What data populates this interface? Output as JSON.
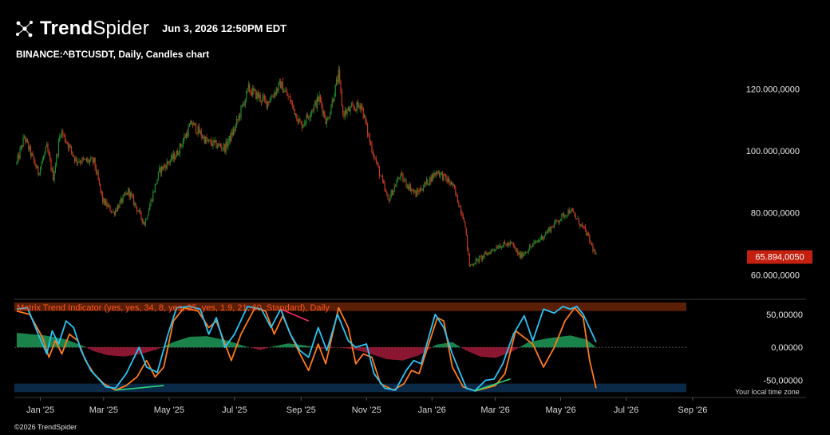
{
  "header": {
    "brand_bold": "Trend",
    "brand_light": "Spider",
    "logo_icon": "network-nodes-icon",
    "timestamp": "Jun 3, 2026 12:50PM EDT",
    "symbol_line": "BINANCE:^BTCUSDT, Daily, Candles chart"
  },
  "footer": {
    "copyright": "©2026 TrendSpider",
    "timezone_note": "Your local time zone"
  },
  "colors": {
    "up": "#1f8a2e",
    "down": "#c33a1c",
    "price_badge": "#c3200f",
    "fast_line": "#2ac4f5",
    "slow_line": "#ff7a1a",
    "ob_zone": "#5a1f05",
    "os_zone": "#0b2a48",
    "hist_pos": "#1f9a58",
    "hist_neg": "#a31a3a",
    "bear_div": "#ff2a6a",
    "bull_div": "#2fd87a"
  },
  "chart_data": [
    {
      "type": "candlestick",
      "title": "BINANCE:^BTCUSDT, Daily, Candles chart",
      "x_range": [
        "2024-12-10",
        "2026-06-03"
      ],
      "ylim": [
        56000,
        126000
      ],
      "yticks": [
        60000,
        80000,
        100000,
        120000
      ],
      "ytick_labels": [
        "60.000,0000",
        "80.000,0000",
        "100.000,0000",
        "120.000,0000"
      ],
      "last_price": 65894.005,
      "last_price_label": "65.894,0050",
      "close_path": [
        [
          "2024-12-10",
          96000
        ],
        [
          "2024-12-17",
          104500
        ],
        [
          "2024-12-30",
          93000
        ],
        [
          "2025-01-07",
          101000
        ],
        [
          "2025-01-13",
          91500
        ],
        [
          "2025-01-20",
          106500
        ],
        [
          "2025-01-27",
          102000
        ],
        [
          "2025-02-03",
          97000
        ],
        [
          "2025-02-20",
          96500
        ],
        [
          "2025-02-28",
          84000
        ],
        [
          "2025-03-10",
          80000
        ],
        [
          "2025-03-24",
          87000
        ],
        [
          "2025-04-08",
          76500
        ],
        [
          "2025-04-22",
          93500
        ],
        [
          "2025-05-08",
          99000
        ],
        [
          "2025-05-22",
          109000
        ],
        [
          "2025-06-05",
          103000
        ],
        [
          "2025-06-22",
          101000
        ],
        [
          "2025-07-01",
          107000
        ],
        [
          "2025-07-14",
          120000
        ],
        [
          "2025-07-31",
          115500
        ],
        [
          "2025-08-13",
          121500
        ],
        [
          "2025-08-22",
          116000
        ],
        [
          "2025-09-01",
          108000
        ],
        [
          "2025-09-18",
          117000
        ],
        [
          "2025-09-25",
          109000
        ],
        [
          "2025-10-06",
          124500
        ],
        [
          "2025-10-10",
          112000
        ],
        [
          "2025-10-27",
          115000
        ],
        [
          "2025-11-04",
          103000
        ],
        [
          "2025-11-21",
          84000
        ],
        [
          "2025-12-02",
          92000
        ],
        [
          "2025-12-17",
          86000
        ],
        [
          "2026-01-06",
          93500
        ],
        [
          "2026-01-20",
          89000
        ],
        [
          "2026-01-31",
          78000
        ],
        [
          "2026-02-05",
          63000
        ],
        [
          "2026-02-20",
          66500
        ],
        [
          "2026-03-04",
          69500
        ],
        [
          "2026-03-16",
          70000
        ],
        [
          "2026-03-24",
          66000
        ],
        [
          "2026-04-13",
          72000
        ],
        [
          "2026-04-28",
          77500
        ],
        [
          "2026-05-10",
          81000
        ],
        [
          "2026-05-25",
          73500
        ],
        [
          "2026-06-03",
          65894
        ]
      ]
    },
    {
      "type": "line",
      "title": "Matrix Trend Indicator (yes, yes, 34, 8, yes, 35, yes, 1.9, 21, 60, Standard), Daily",
      "ylim": [
        -70,
        68
      ],
      "yticks": [
        50,
        0,
        -50
      ],
      "ytick_labels": [
        "50,00000",
        "0,00000",
        "-50,00000"
      ],
      "bands": {
        "overbought": [
          55,
          68
        ],
        "oversold": [
          -68,
          -55
        ]
      },
      "series": [
        {
          "role": "fast",
          "values": [
            [
              "2024-12-10",
              58
            ],
            [
              "2024-12-20",
              60
            ],
            [
              "2024-12-30",
              20
            ],
            [
              "2025-01-07",
              -10
            ],
            [
              "2025-01-12",
              25
            ],
            [
              "2025-01-18",
              5
            ],
            [
              "2025-01-25",
              40
            ],
            [
              "2025-02-01",
              30
            ],
            [
              "2025-02-08",
              -5
            ],
            [
              "2025-02-17",
              -35
            ],
            [
              "2025-03-03",
              -60
            ],
            [
              "2025-03-12",
              -62
            ],
            [
              "2025-03-22",
              -40
            ],
            [
              "2025-04-03",
              0
            ],
            [
              "2025-04-10",
              -30
            ],
            [
              "2025-04-20",
              -38
            ],
            [
              "2025-04-30",
              20
            ],
            [
              "2025-05-08",
              60
            ],
            [
              "2025-05-20",
              62
            ],
            [
              "2025-05-30",
              58
            ],
            [
              "2025-06-07",
              20
            ],
            [
              "2025-06-14",
              45
            ],
            [
              "2025-06-22",
              0
            ],
            [
              "2025-07-01",
              20
            ],
            [
              "2025-07-13",
              62
            ],
            [
              "2025-07-26",
              58
            ],
            [
              "2025-08-04",
              30
            ],
            [
              "2025-08-13",
              58
            ],
            [
              "2025-08-22",
              20
            ],
            [
              "2025-08-31",
              -5
            ],
            [
              "2025-09-08",
              -15
            ],
            [
              "2025-09-17",
              30
            ],
            [
              "2025-09-25",
              -5
            ],
            [
              "2025-10-05",
              50
            ],
            [
              "2025-10-15",
              10
            ],
            [
              "2025-10-22",
              0
            ],
            [
              "2025-11-01",
              5
            ],
            [
              "2025-11-08",
              -40
            ],
            [
              "2025-11-18",
              -62
            ],
            [
              "2025-11-28",
              -65
            ],
            [
              "2025-12-08",
              -35
            ],
            [
              "2025-12-15",
              -20
            ],
            [
              "2025-12-22",
              -25
            ],
            [
              "2026-01-04",
              50
            ],
            [
              "2026-01-12",
              30
            ],
            [
              "2026-01-20",
              -10
            ],
            [
              "2026-02-02",
              -62
            ],
            [
              "2026-02-10",
              -66
            ],
            [
              "2026-02-20",
              -50
            ],
            [
              "2026-02-28",
              -48
            ],
            [
              "2026-03-08",
              -25
            ],
            [
              "2026-03-18",
              20
            ],
            [
              "2026-03-28",
              48
            ],
            [
              "2026-04-05",
              10
            ],
            [
              "2026-04-15",
              58
            ],
            [
              "2026-04-25",
              52
            ],
            [
              "2026-05-03",
              62
            ],
            [
              "2026-05-10",
              58
            ],
            [
              "2026-05-16",
              62
            ],
            [
              "2026-05-22",
              50
            ],
            [
              "2026-06-03",
              8
            ]
          ]
        },
        {
          "role": "slow",
          "values": [
            [
              "2024-12-10",
              55
            ],
            [
              "2024-12-22",
              50
            ],
            [
              "2025-01-03",
              15
            ],
            [
              "2025-01-09",
              -15
            ],
            [
              "2025-01-15",
              10
            ],
            [
              "2025-01-21",
              -10
            ],
            [
              "2025-01-28",
              20
            ],
            [
              "2025-02-05",
              10
            ],
            [
              "2025-02-12",
              -20
            ],
            [
              "2025-02-20",
              -40
            ],
            [
              "2025-03-01",
              -55
            ],
            [
              "2025-03-12",
              -65
            ],
            [
              "2025-03-22",
              -58
            ],
            [
              "2025-04-01",
              -45
            ],
            [
              "2025-04-10",
              -20
            ],
            [
              "2025-04-18",
              -45
            ],
            [
              "2025-04-26",
              -30
            ],
            [
              "2025-05-05",
              40
            ],
            [
              "2025-05-15",
              60
            ],
            [
              "2025-05-28",
              55
            ],
            [
              "2025-06-07",
              30
            ],
            [
              "2025-06-14",
              40
            ],
            [
              "2025-06-21",
              10
            ],
            [
              "2025-06-28",
              -20
            ],
            [
              "2025-07-07",
              20
            ],
            [
              "2025-07-20",
              60
            ],
            [
              "2025-07-30",
              55
            ],
            [
              "2025-08-07",
              20
            ],
            [
              "2025-08-15",
              48
            ],
            [
              "2025-08-22",
              20
            ],
            [
              "2025-08-31",
              -10
            ],
            [
              "2025-09-08",
              -35
            ],
            [
              "2025-09-17",
              5
            ],
            [
              "2025-09-24",
              -25
            ],
            [
              "2025-10-06",
              60
            ],
            [
              "2025-10-15",
              30
            ],
            [
              "2025-10-22",
              -25
            ],
            [
              "2025-10-29",
              -10
            ],
            [
              "2025-11-06",
              -15
            ],
            [
              "2025-11-14",
              -55
            ],
            [
              "2025-11-26",
              -65
            ],
            [
              "2025-12-06",
              -55
            ],
            [
              "2025-12-13",
              -35
            ],
            [
              "2025-12-20",
              -40
            ],
            [
              "2025-12-28",
              0
            ],
            [
              "2026-01-06",
              45
            ],
            [
              "2026-01-12",
              40
            ],
            [
              "2026-01-20",
              -30
            ],
            [
              "2026-01-30",
              -60
            ],
            [
              "2026-02-10",
              -66
            ],
            [
              "2026-02-20",
              -62
            ],
            [
              "2026-03-01",
              -58
            ],
            [
              "2026-03-10",
              -40
            ],
            [
              "2026-03-20",
              25
            ],
            [
              "2026-03-28",
              15
            ],
            [
              "2026-04-05",
              5
            ],
            [
              "2026-04-15",
              -30
            ],
            [
              "2026-04-25",
              0
            ],
            [
              "2026-05-05",
              40
            ],
            [
              "2026-05-14",
              60
            ],
            [
              "2026-05-22",
              45
            ],
            [
              "2026-05-28",
              -20
            ],
            [
              "2026-06-03",
              -62
            ]
          ]
        },
        {
          "role": "histogram",
          "values": [
            [
              "2024-12-10",
              22
            ],
            [
              "2025-01-05",
              18
            ],
            [
              "2025-01-25",
              12
            ],
            [
              "2025-02-10",
              2
            ],
            [
              "2025-02-20",
              -6
            ],
            [
              "2025-03-05",
              -12
            ],
            [
              "2025-03-20",
              -14
            ],
            [
              "2025-04-05",
              -10
            ],
            [
              "2025-04-20",
              -3
            ],
            [
              "2025-05-05",
              8
            ],
            [
              "2025-05-20",
              16
            ],
            [
              "2025-06-05",
              17
            ],
            [
              "2025-06-25",
              10
            ],
            [
              "2025-07-10",
              2
            ],
            [
              "2025-07-25",
              -4
            ],
            [
              "2025-08-05",
              1
            ],
            [
              "2025-08-20",
              6
            ],
            [
              "2025-09-05",
              3
            ],
            [
              "2025-09-20",
              -2
            ],
            [
              "2025-10-05",
              0
            ],
            [
              "2025-10-20",
              -3
            ],
            [
              "2025-11-05",
              -10
            ],
            [
              "2025-11-20",
              -18
            ],
            [
              "2025-12-05",
              -20
            ],
            [
              "2025-12-20",
              -12
            ],
            [
              "2026-01-05",
              4
            ],
            [
              "2026-01-20",
              8
            ],
            [
              "2026-02-01",
              -4
            ],
            [
              "2026-02-15",
              -14
            ],
            [
              "2026-03-01",
              -16
            ],
            [
              "2026-03-15",
              -8
            ],
            [
              "2026-04-01",
              8
            ],
            [
              "2026-04-20",
              14
            ],
            [
              "2026-05-10",
              18
            ],
            [
              "2026-05-25",
              12
            ],
            [
              "2026-06-03",
              0
            ]
          ]
        }
      ],
      "divergences": [
        {
          "kind": "bearish",
          "from": [
            "2025-08-13",
            58
          ],
          "to": [
            "2025-09-08",
            40
          ]
        },
        {
          "kind": "bullish",
          "from": [
            "2025-03-12",
            -65
          ],
          "to": [
            "2025-04-26",
            -58
          ]
        },
        {
          "kind": "bullish",
          "from": [
            "2026-02-10",
            -66
          ],
          "to": [
            "2026-03-15",
            -48
          ]
        }
      ]
    }
  ],
  "x_axis": {
    "ticks": [
      [
        "2025-01-01",
        "Jan '25"
      ],
      [
        "2025-03-01",
        "Mar '25"
      ],
      [
        "2025-05-01",
        "May '25"
      ],
      [
        "2025-07-01",
        "Jul '25"
      ],
      [
        "2025-09-01",
        "Sep '25"
      ],
      [
        "2025-11-01",
        "Nov '25"
      ],
      [
        "2026-01-01",
        "Jan '26"
      ],
      [
        "2026-03-01",
        "Mar '26"
      ],
      [
        "2026-05-01",
        "May '26"
      ],
      [
        "2026-07-01",
        "Jul '26"
      ],
      [
        "2026-09-01",
        "Sep '26"
      ]
    ]
  }
}
